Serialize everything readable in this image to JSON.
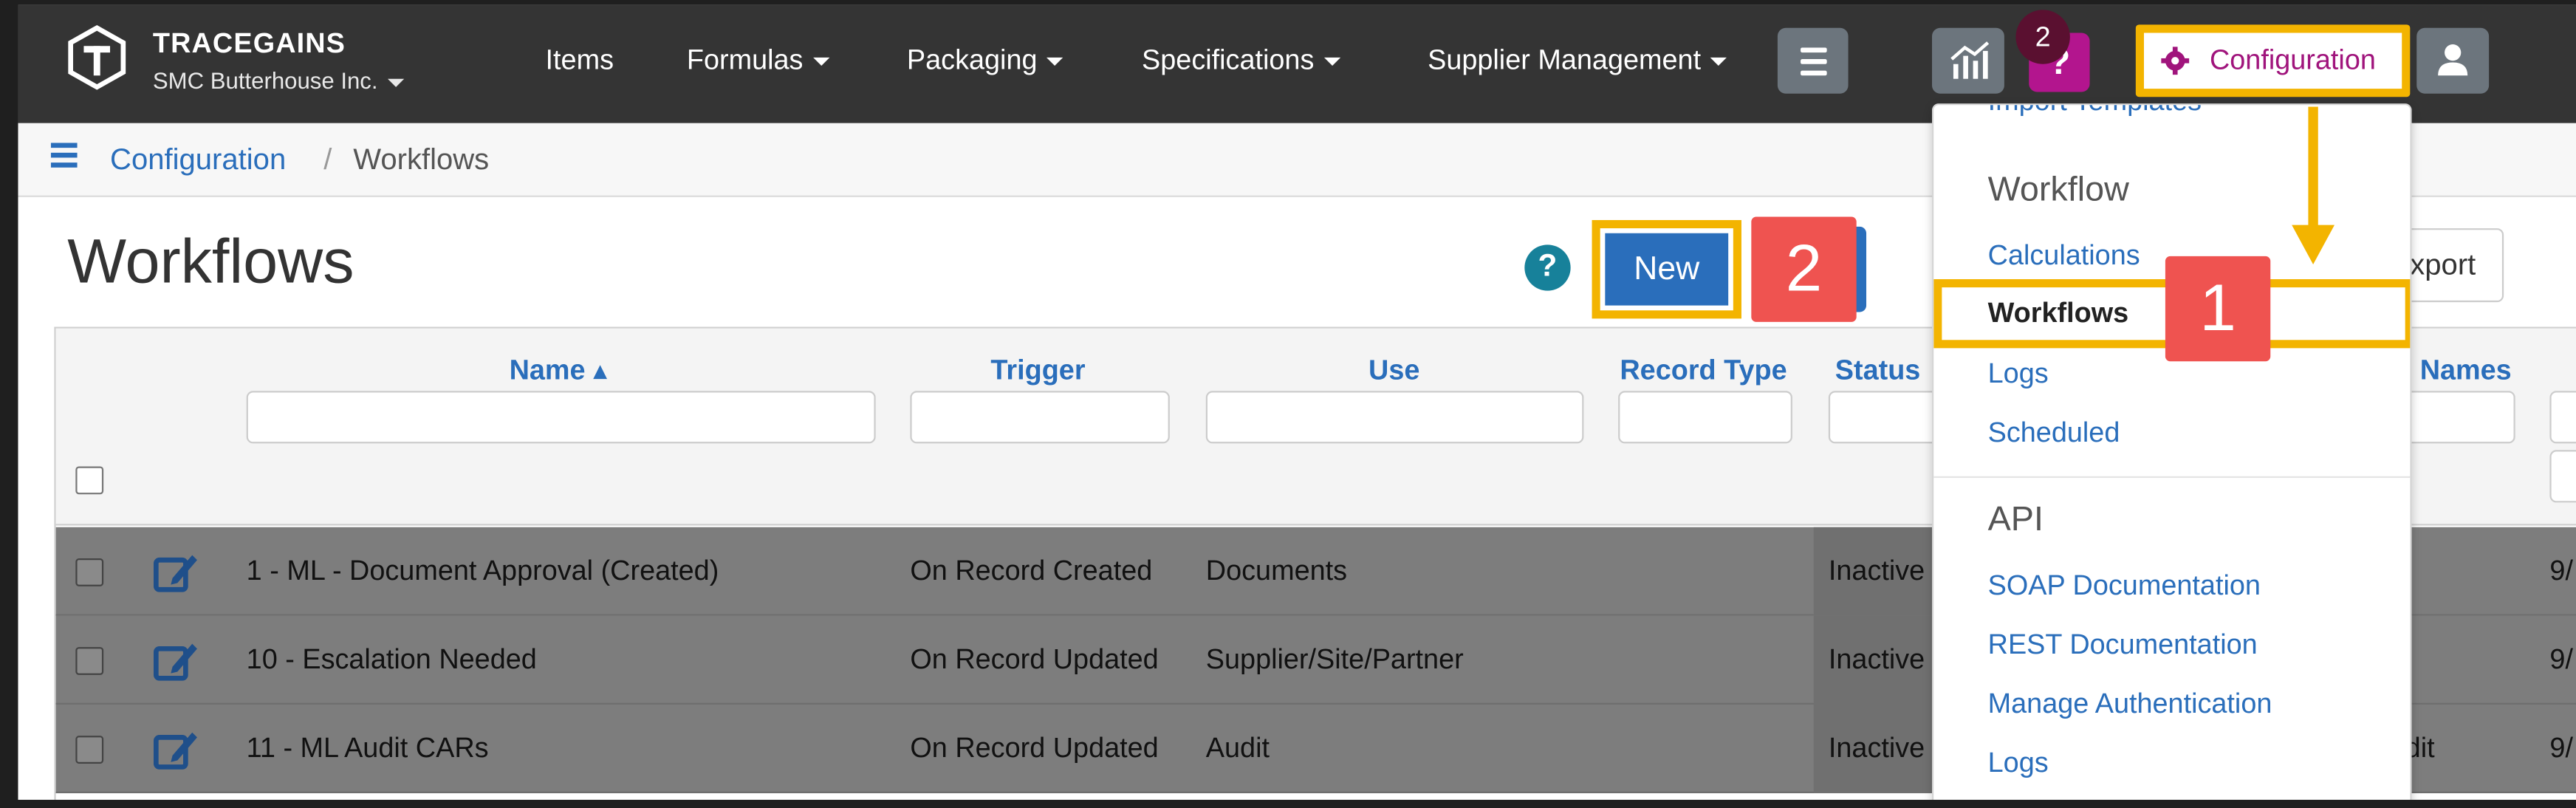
{
  "navbar": {
    "brand": "TRACEGAINS",
    "tenant": "SMC Butterhouse Inc.",
    "links": [
      "Items",
      "Formulas",
      "Packaging",
      "Specifications",
      "Supplier Management"
    ],
    "badge_count": "2",
    "help_label": "?",
    "config_label": "Configuration",
    "colors": {
      "bar": "#343434",
      "accent": "#b3158e",
      "highlight": "#f3b400"
    }
  },
  "breadcrumb": {
    "parent": "Configuration",
    "separator": "/",
    "current": "Workflows"
  },
  "page": {
    "title": "Workflows",
    "help_label": "?",
    "new_label": "New",
    "export_label": "xport",
    "annotation_new": "2",
    "annotation_workflows": "1"
  },
  "table": {
    "columns": [
      "Name ▴",
      "Trigger",
      "Use",
      "Record Type",
      "Status",
      "Names"
    ],
    "rows": [
      {
        "name": "1 - ML - Document Approval (Created)",
        "trigger": "On Record Created",
        "use": "Documents",
        "status": "Inactive",
        "extra": "",
        "date": "9/"
      },
      {
        "name": "10 - Escalation Needed",
        "trigger": "On Record Updated",
        "use": "Supplier/Site/Partner",
        "status": "Inactive",
        "extra": "",
        "date": "9/"
      },
      {
        "name": "11 - ML Audit CARs",
        "trigger": "On Record Updated",
        "use": "Audit",
        "status": "Inactive",
        "extra": "dit",
        "date": "9/"
      }
    ]
  },
  "dropdown": {
    "cut_item": "Import Templates",
    "workflow_header": "Workflow",
    "workflow_items": [
      "Calculations",
      "Workflows",
      "Logs",
      "Scheduled"
    ],
    "api_header": "API",
    "api_items": [
      "SOAP Documentation",
      "REST Documentation",
      "Manage Authentication",
      "Logs"
    ]
  }
}
